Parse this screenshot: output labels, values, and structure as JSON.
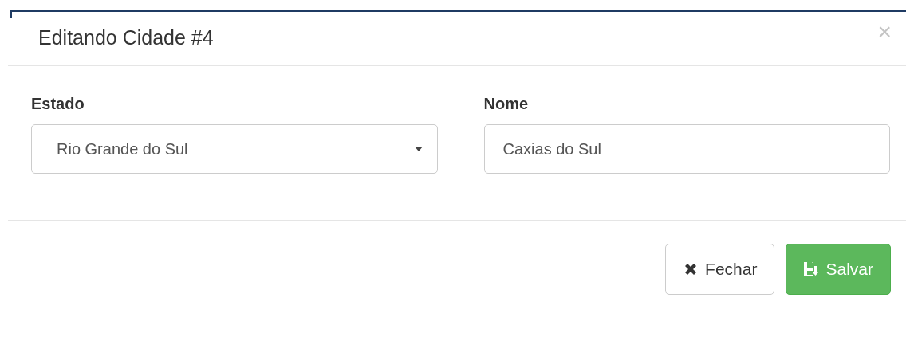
{
  "modal": {
    "title": "Editando Cidade #4",
    "close": "×"
  },
  "fields": [
    {
      "kind": "select",
      "label": "Estado",
      "value": "Rio Grande do Sul"
    },
    {
      "kind": "text",
      "label": "Nome",
      "value": "Caxias do Sul"
    }
  ],
  "buttons": [
    {
      "kind": "close",
      "label": "Fechar"
    },
    {
      "kind": "save",
      "label": "Salvar"
    }
  ]
}
